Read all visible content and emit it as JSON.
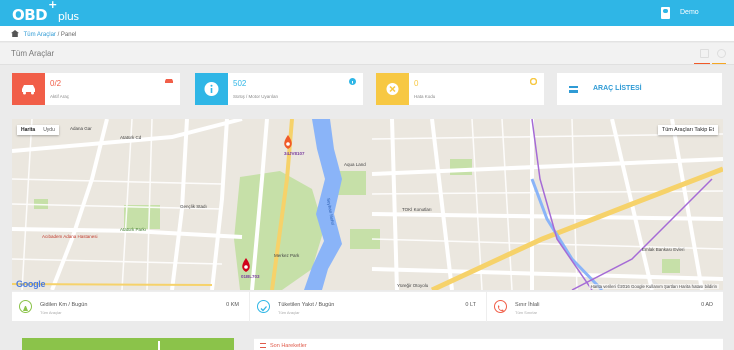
{
  "header": {
    "logo_main": "OBD",
    "logo_plus": "+",
    "logo_sub": "plus",
    "user_name": "Demo"
  },
  "breadcrumb": {
    "link": "Tüm Araçlar",
    "separator": "/",
    "current": "Panel"
  },
  "page": {
    "title": "Tüm Araçlar"
  },
  "cards": [
    {
      "value": "0/2",
      "label": "Aktif Araç",
      "color": "#f15e48"
    },
    {
      "value": "502",
      "label": "Sürüş / Motor Uyarıları",
      "color": "#2fb6e6"
    },
    {
      "value": "0",
      "label": "Hata Kodu",
      "color": "#f7c843"
    }
  ],
  "list_card": {
    "label": "ARAÇ LİSTESİ"
  },
  "map": {
    "type_map": "Harita",
    "type_sat": "Uydu",
    "follow_label": "Tüm Araçları Takip Et",
    "marker_1": "34JV8107",
    "marker_2": "01BL703",
    "footer": "Harita verileri ©2016 Google   Kullanım Şartları   Harita hatası bildirin",
    "google": "Google",
    "labels": {
      "adana": "Adana Gar",
      "ataturk_cd": "Atatürk Cd",
      "genclik": "Gençlik Stadı",
      "merkez": "Merkez Park",
      "ataturk_park": "Atatürk Parkı",
      "acibadem": "Acıbadem Adana Hastanesi",
      "aqua": "Aqua Land",
      "toki": "TOKİ Konutları",
      "seyhan": "Seyhan Nehri",
      "emlak": "Emlak Bankası Evleri",
      "yureir": "Yüreğir Otoyolu"
    }
  },
  "stats": [
    {
      "title": "Gidilen Km / Bugün",
      "sub": "Tüm Araçlar",
      "value": "0 KM",
      "color": "#8bc34a"
    },
    {
      "title": "Tüketilen Yakıt / Bugün",
      "sub": "Tüm Araçlar",
      "value": "0 LT",
      "color": "#2fb6e6"
    },
    {
      "title": "Sınır İhlali",
      "sub": "Tüm Sınırlar",
      "value": "0 AD",
      "color": "#f15e48"
    }
  ],
  "recent": {
    "title": "Son Hareketler"
  }
}
